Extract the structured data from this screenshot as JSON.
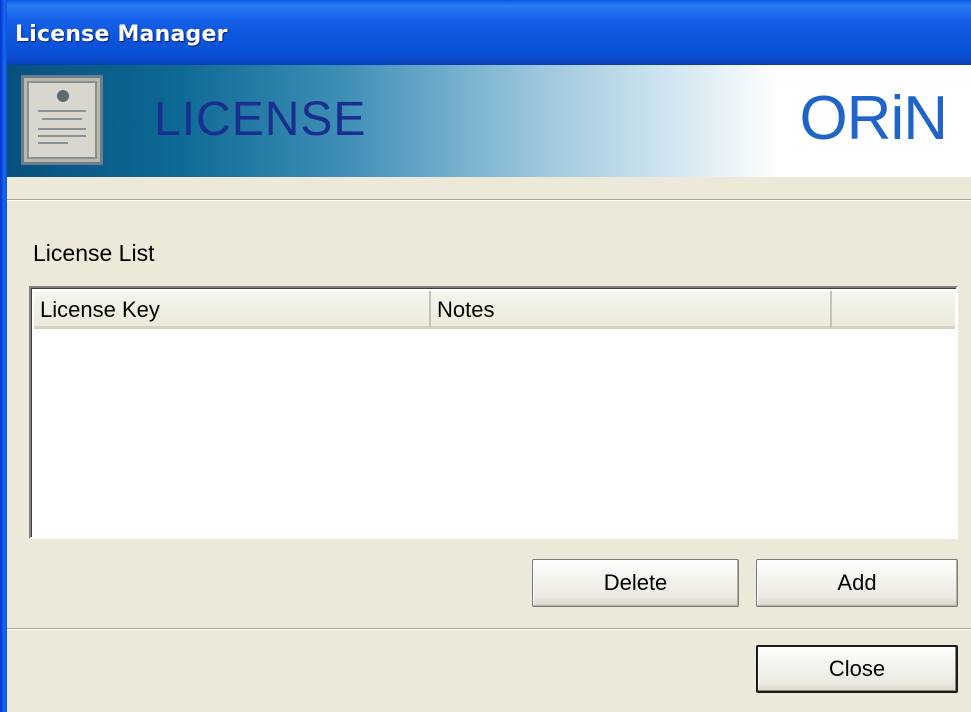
{
  "window": {
    "title": "License Manager"
  },
  "banner": {
    "title": "LICENSE",
    "logo_text": "ORiN",
    "cert_icon": "certificate-icon"
  },
  "license_list": {
    "label": "License List",
    "columns": [
      "License Key",
      "Notes",
      ""
    ],
    "rows": []
  },
  "buttons": {
    "delete_label": "Delete",
    "add_label": "Add",
    "close_label": "Close"
  },
  "colors": {
    "titlebar": "#0c55db",
    "banner_dark": "#07507e",
    "banner_title": "#1a2e8f",
    "logo": "#1f64c8",
    "dialog_bg": "#ece9d8"
  }
}
